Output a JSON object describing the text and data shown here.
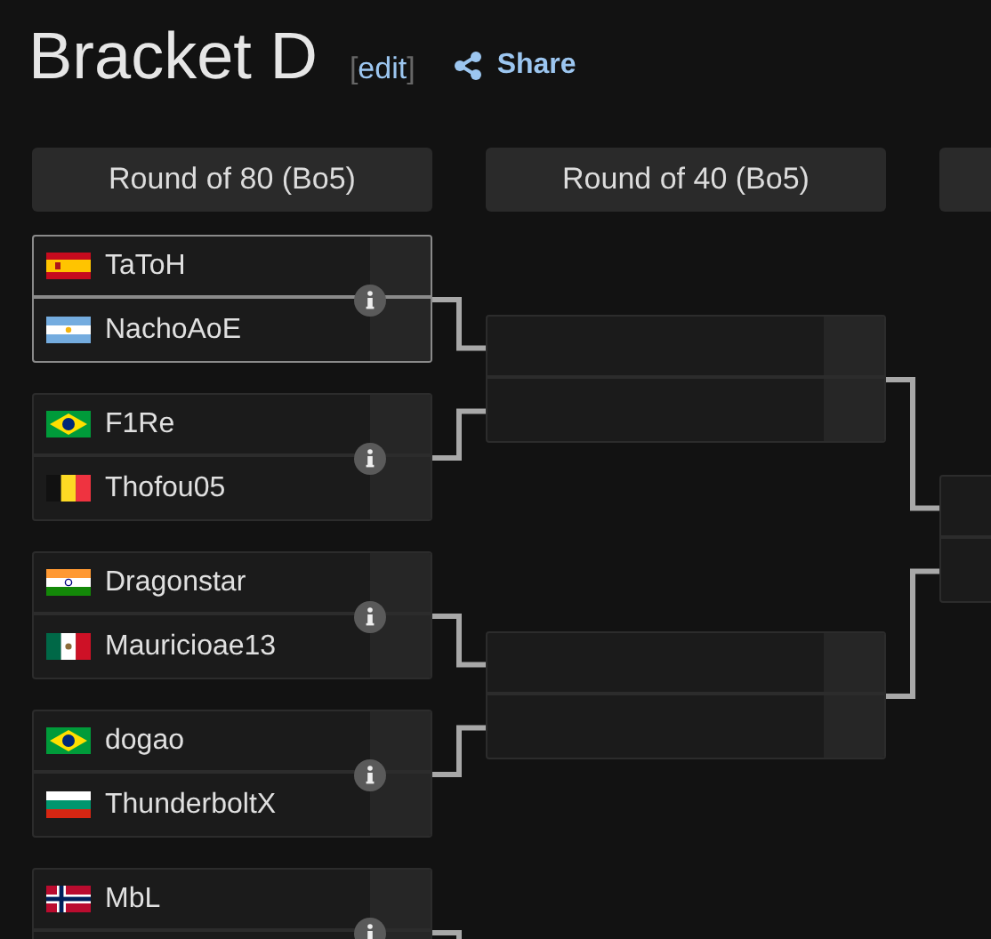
{
  "title": "Bracket D",
  "edit_link": {
    "open": "[",
    "label": "edit",
    "close": "]"
  },
  "share_link": {
    "label": "Share"
  },
  "rounds": [
    {
      "header": "Round of 80 (Bo5)",
      "matches": [
        {
          "highlighted": true,
          "info_icon": true,
          "players": [
            {
              "name": "TaToH",
              "kind": "es"
            },
            {
              "name": "NachoAoE",
              "kind": "ar"
            }
          ]
        },
        {
          "highlighted": false,
          "info_icon": true,
          "players": [
            {
              "name": "F1Re",
              "kind": "br"
            },
            {
              "name": "Thofou05",
              "kind": "be"
            }
          ]
        },
        {
          "highlighted": false,
          "info_icon": true,
          "players": [
            {
              "name": "Dragonstar",
              "kind": "in"
            },
            {
              "name": "Mauricioae13",
              "kind": "mx"
            }
          ]
        },
        {
          "highlighted": false,
          "info_icon": true,
          "players": [
            {
              "name": "dogao",
              "kind": "br"
            },
            {
              "name": "ThunderboltX",
              "kind": "bg"
            }
          ]
        },
        {
          "highlighted": false,
          "info_icon": true,
          "players": [
            {
              "name": "MbL",
              "kind": "no"
            }
          ]
        }
      ]
    },
    {
      "header": "Round of 40 (Bo5)",
      "matches": [
        {
          "highlighted": false,
          "info_icon": false
        },
        {
          "highlighted": false,
          "info_icon": false
        }
      ]
    },
    {
      "matches": [
        {
          "highlighted": false,
          "info_icon": false
        }
      ]
    }
  ]
}
